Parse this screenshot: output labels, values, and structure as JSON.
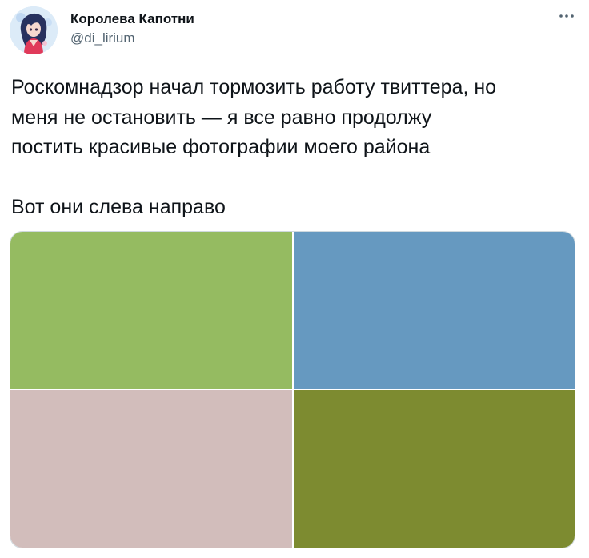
{
  "author": {
    "display_name": "Королева Капотни",
    "handle": "@di_lirium",
    "avatar_icon": "anime-girl-avatar-icon"
  },
  "menu": {
    "icon": "more-horizontal-icon"
  },
  "tweet": {
    "lines": [
      "Роскомнадзор начал тормозить работу твиттера, но",
      "меня не остановить — я все равно продолжу",
      "постить красивые фотографии моего района"
    ],
    "second_paragraph": "Вот они слева направо"
  },
  "media": {
    "photos": [
      {
        "color": "#95bb61"
      },
      {
        "color": "#6699c0"
      },
      {
        "color": "#d2bdbb"
      },
      {
        "color": "#7d8b30"
      }
    ]
  }
}
